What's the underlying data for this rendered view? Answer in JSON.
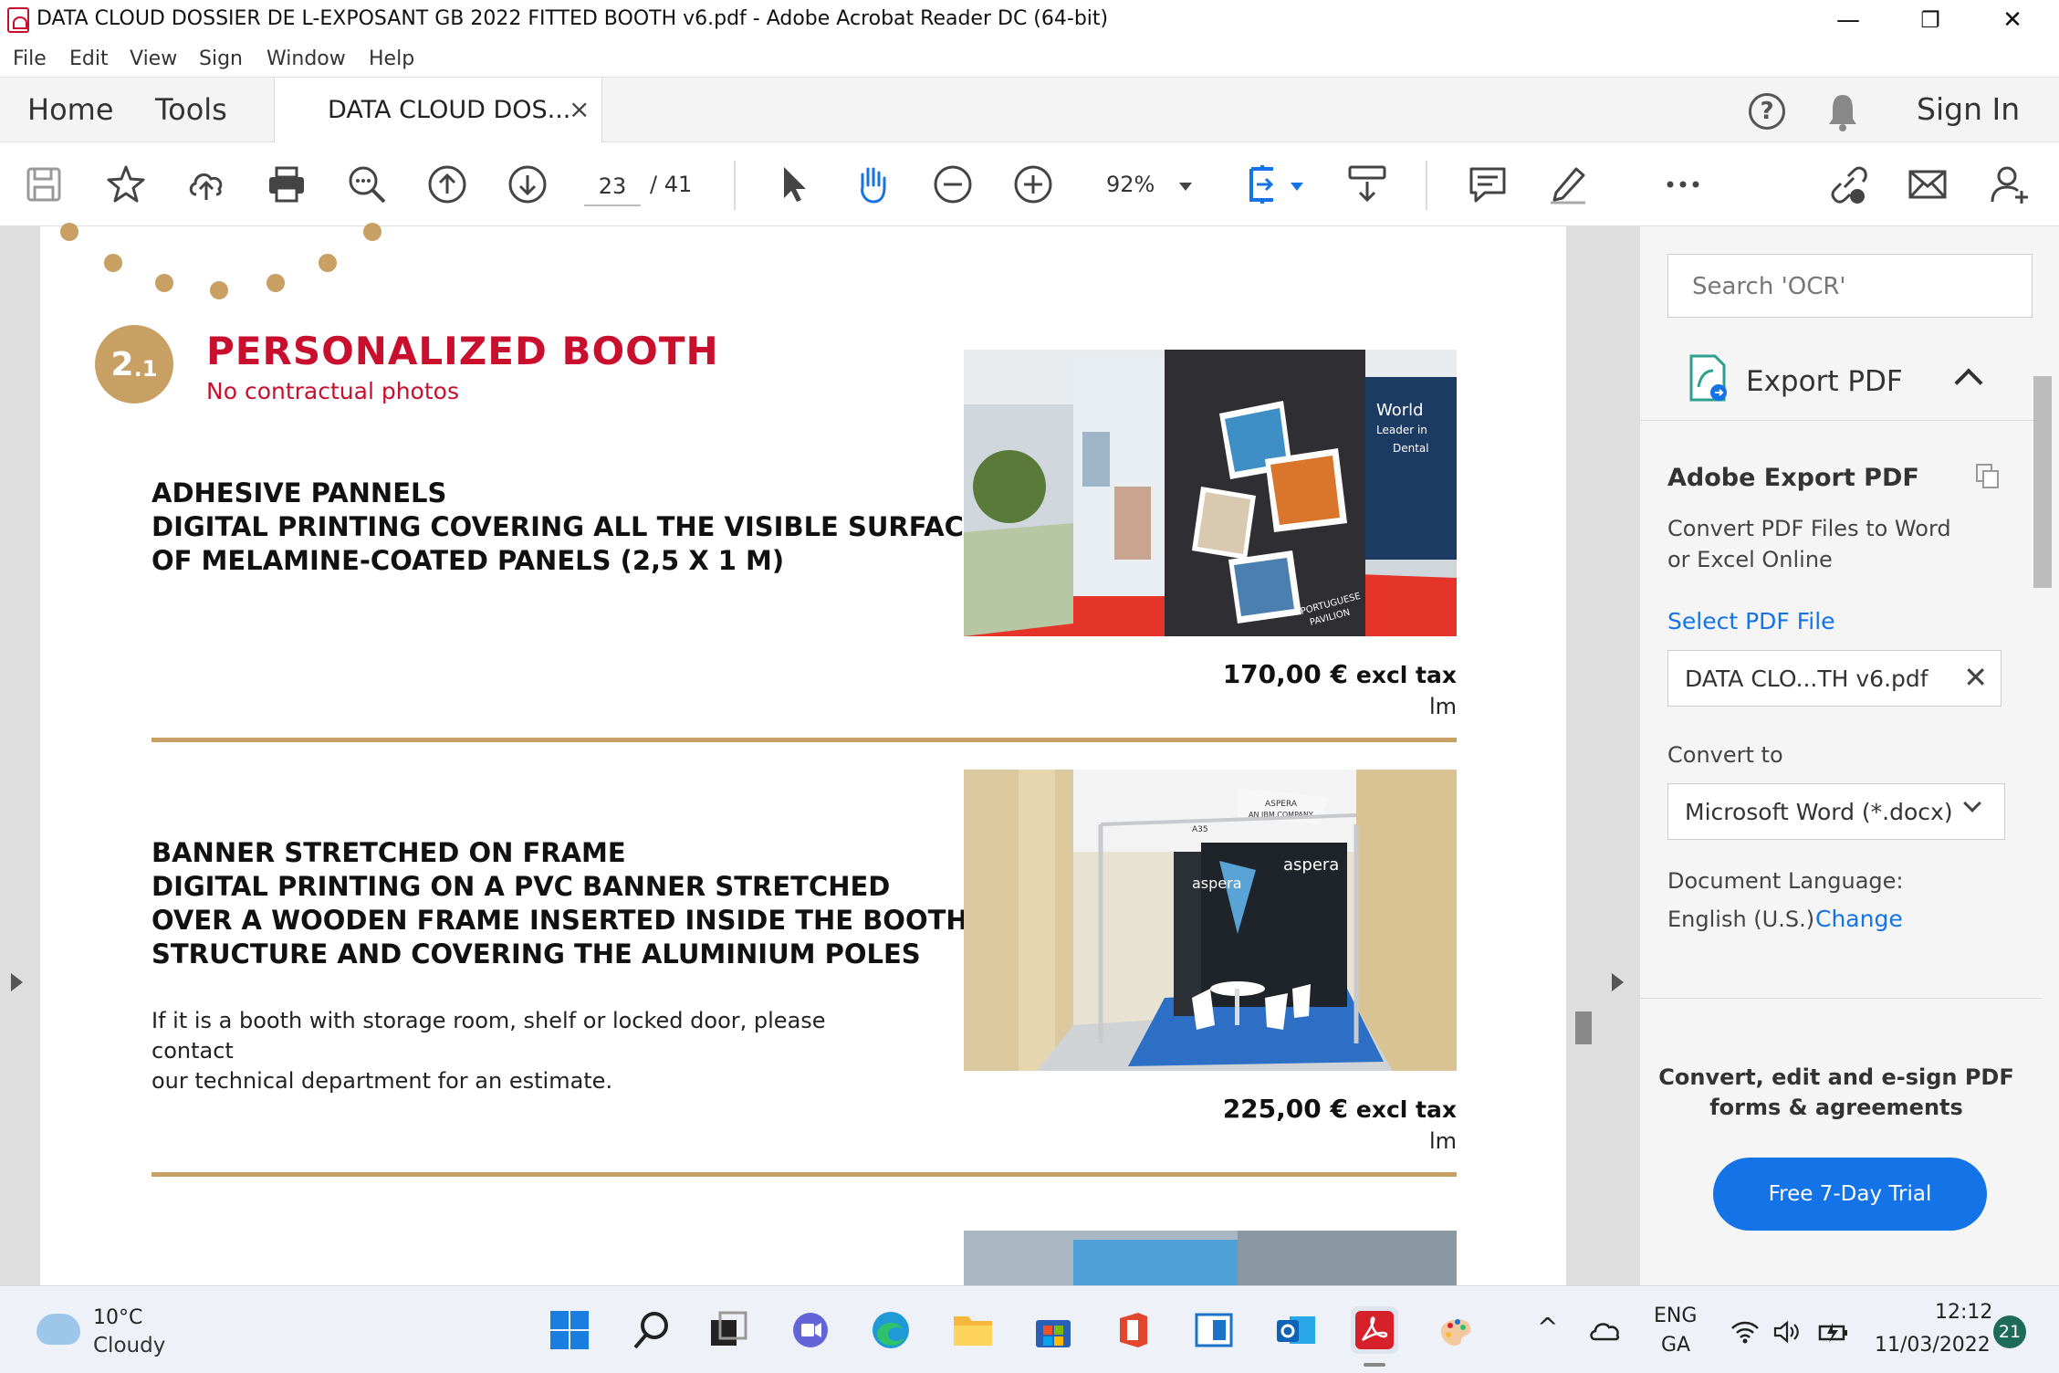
{
  "window": {
    "title": "DATA CLOUD DOSSIER DE L-EXPOSANT GB 2022 FITTED BOOTH v6.pdf - Adobe Acrobat Reader DC (64-bit)",
    "minimize": "—",
    "maximize": "❐",
    "close": "✕"
  },
  "menu": [
    "File",
    "Edit",
    "View",
    "Sign",
    "Window",
    "Help"
  ],
  "tabs": {
    "home": "Home",
    "tools": "Tools",
    "doc_tab": "DATA CLOUD DOS...",
    "doc_close": "×",
    "help": "?",
    "signin": "Sign In"
  },
  "toolbar": {
    "page_current": "23",
    "page_total": "/  41",
    "zoom": "92%"
  },
  "document": {
    "badge_main": "2",
    "badge_sub": ".1",
    "section_title": "PERSONALIZED BOOTH",
    "section_subtitle": "No contractual photos",
    "item1": {
      "heading": "ADHESIVE PANNELS\nDIGITAL PRINTING COVERING ALL THE VISIBLE SURFACE\nOF MELAMINE-COATED PANELS (2,5 X 1 M)",
      "price": "170,00 €",
      "tax": "excl tax",
      "unit": "lm"
    },
    "item2": {
      "heading": "BANNER STRETCHED ON FRAME\nDIGITAL PRINTING ON A PVC BANNER STRETCHED\nOVER A WOODEN FRAME INSERTED INSIDE THE BOOTH\nSTRUCTURE AND COVERING THE ALUMINIUM POLES",
      "note": "If it is a booth with storage room, shelf or locked door, please contact\nour technical department for an estimate.",
      "price": "225,00 €",
      "tax": "excl tax",
      "unit": "lm"
    },
    "photo1_text": {
      "world": "World",
      "leader": "Leader in",
      "dental": "Dental",
      "portuguese": "PORTUGUESE",
      "pavilion": "PAVILION"
    },
    "photo2_text": {
      "aspera_top": "ASPERA",
      "ibm": "AN IBM COMPANY",
      "booth_no": "A35",
      "aspera_left": "aspera",
      "aspera_right": "aspera"
    }
  },
  "right_pane": {
    "search_placeholder": "Search 'OCR'",
    "export_label": "Export PDF",
    "adobe_export_title": "Adobe Export PDF",
    "adobe_export_desc": "Convert PDF Files to Word\nor Excel Online",
    "select_file": "Select PDF File",
    "file_name": "DATA CLO...TH v6.pdf",
    "file_clear": "✕",
    "convert_to": "Convert to",
    "format": "Microsoft Word (*.docx)",
    "doc_lang_label": "Document Language:",
    "doc_lang_value": "English (U.S.)",
    "change": "Change",
    "promo": "Convert, edit and e-sign PDF\nforms & agreements",
    "trial": "Free 7-Day Trial"
  },
  "taskbar": {
    "temp": "10°C",
    "condition": "Cloudy",
    "lang1": "ENG",
    "lang2": "GA",
    "time": "12:12",
    "date": "11/03/2022",
    "notifications": "21"
  },
  "colors": {
    "accent_gold": "#c8a064",
    "accent_red": "#c8102e",
    "adobe_blue": "#1473e6"
  }
}
